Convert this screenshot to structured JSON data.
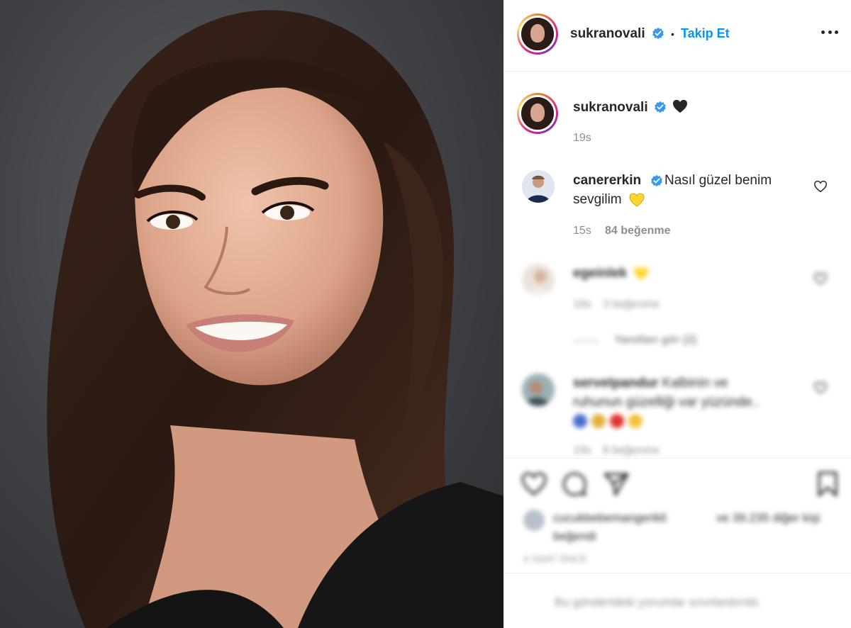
{
  "post": {
    "author": "sukranovali",
    "follow_label": "Takip Et",
    "separator": "•"
  },
  "caption": {
    "author": "sukranovali",
    "emoji": "black-heart",
    "time": "19s"
  },
  "comments": [
    {
      "author": "canererkin",
      "text_line1": "Nasıl güzel benim",
      "text_line2": "sevgilim",
      "emoji": "yellow-heart",
      "time": "15s",
      "likes": "84 beğenme",
      "verified": true
    },
    {
      "author": "egeinlek",
      "emoji": "yellow-heart",
      "time": "19s",
      "likes": "3 beğenme",
      "replies": "Yanıtları gör (2)",
      "blurred": true
    },
    {
      "author": "servetpandur",
      "text_line1": "Kalbinin ve",
      "text_line2": "ruhunun güzelliği var yüzünde..",
      "time": "19s",
      "likes": "8 beğenme",
      "blurred": true
    }
  ],
  "likes_summary": {
    "user": "cucukbebemangerikli",
    "text": "ve 39.235 diğer kişi",
    "text2": "beğendi",
    "date": "4 SAAT ÖNCE",
    "blurred": true
  },
  "footer": {
    "notice": "Bu gönderideki yorumlar sınırlandırıldı.",
    "blurred": true
  },
  "colors": {
    "accent": "#0095f6",
    "verified": "#3897f0",
    "muted": "#8e8e8e",
    "text": "#262626"
  }
}
